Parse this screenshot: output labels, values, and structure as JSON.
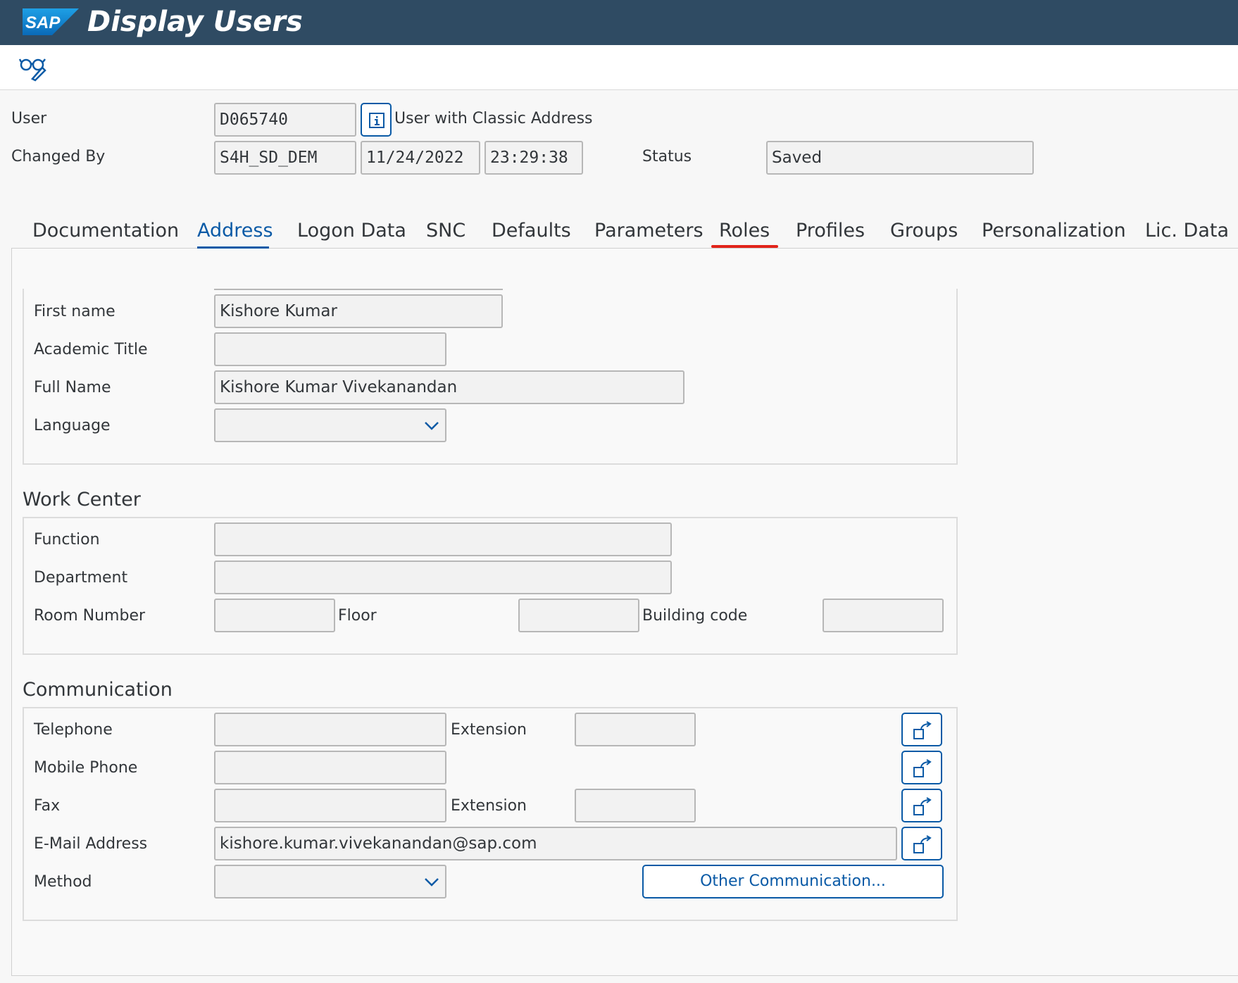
{
  "app": {
    "logo_text": "SAP",
    "title": "Display Users"
  },
  "header": {
    "user_label": "User",
    "user_value": "D065740",
    "user_type_text": "User with Classic Address",
    "changed_by_label": "Changed By",
    "changed_by_value": "S4H_SD_DEM",
    "changed_date": "11/24/2022",
    "changed_time": "23:29:38",
    "status_label": "Status",
    "status_value": "Saved"
  },
  "tabs": [
    {
      "label": "Documentation"
    },
    {
      "label": "Address",
      "active": true
    },
    {
      "label": "Logon Data"
    },
    {
      "label": "SNC"
    },
    {
      "label": "Defaults"
    },
    {
      "label": "Parameters"
    },
    {
      "label": "Roles"
    },
    {
      "label": "Profiles"
    },
    {
      "label": "Groups"
    },
    {
      "label": "Personalization"
    },
    {
      "label": "Lic. Data"
    }
  ],
  "person": {
    "first_name_label": "First name",
    "first_name_value": "Kishore Kumar",
    "academic_title_label": "Academic Title",
    "academic_title_value": "",
    "full_name_label": "Full Name",
    "full_name_value": "Kishore Kumar Vivekanandan",
    "language_label": "Language",
    "language_value": ""
  },
  "work_center": {
    "title": "Work Center",
    "function_label": "Function",
    "department_label": "Department",
    "room_number_label": "Room Number",
    "floor_label": "Floor",
    "building_code_label": "Building code"
  },
  "communication": {
    "title": "Communication",
    "telephone_label": "Telephone",
    "extension_label": "Extension",
    "mobile_label": "Mobile Phone",
    "fax_label": "Fax",
    "fax_extension_label": "Extension",
    "email_label": "E-Mail Address",
    "email_value": "kishore.kumar.vivekanandan@sap.com",
    "method_label": "Method",
    "method_value": "",
    "other_button": "Other Communication..."
  },
  "colors": {
    "header_bg": "#2f4b63",
    "accent": "#0a5aa6",
    "highlight_underline": "#e2231a"
  }
}
